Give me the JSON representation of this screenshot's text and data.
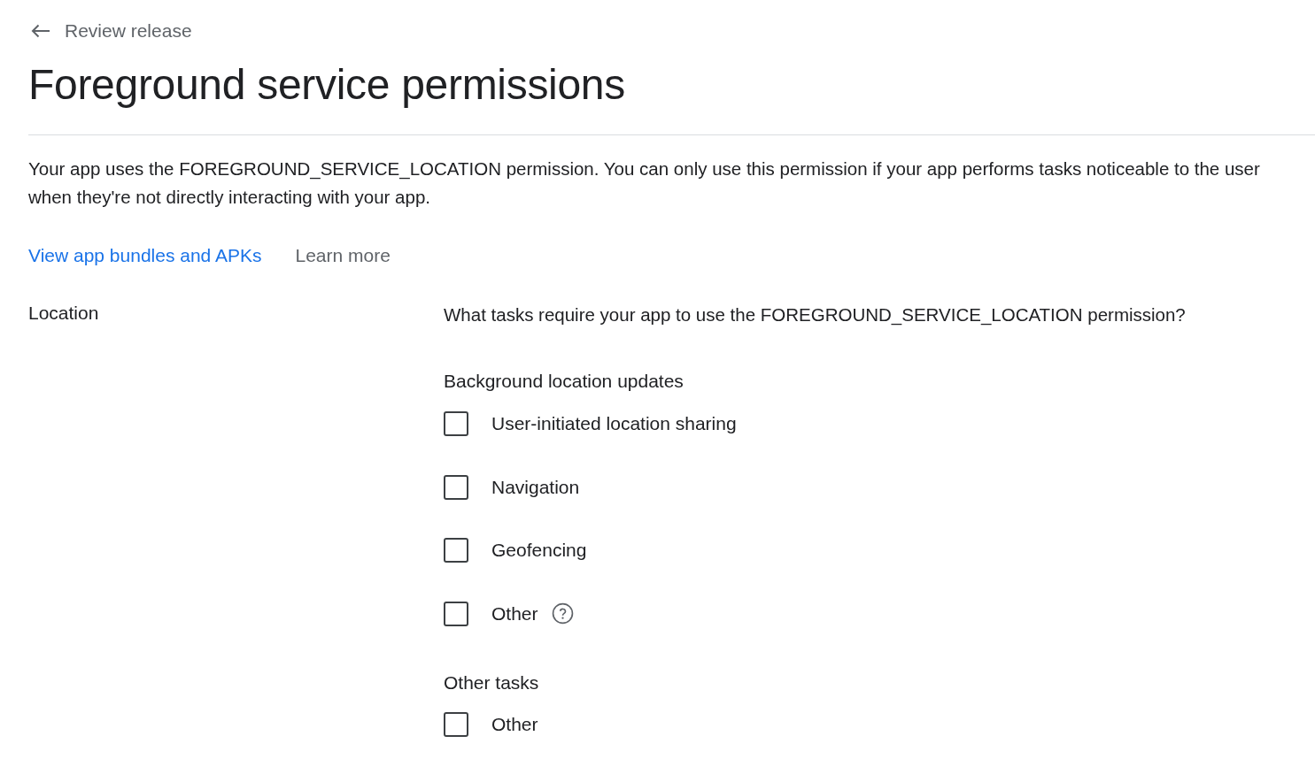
{
  "back_link": {
    "label": "Review release"
  },
  "title": "Foreground service permissions",
  "description": "Your app uses the FOREGROUND_SERVICE_LOCATION permission. You can only use this permission if your app performs tasks noticeable to the user when they're not directly interacting with your app.",
  "links": [
    {
      "label": "View app bundles and APKs",
      "kind": "primary"
    },
    {
      "label": "Learn more",
      "kind": "secondary"
    }
  ],
  "sections": [
    {
      "label": "Location",
      "question": "What tasks require your app to use the FOREGROUND_SERVICE_LOCATION permission?",
      "groups": [
        {
          "title": "Background location updates",
          "options": [
            {
              "label": "User-initiated location sharing",
              "checked": false,
              "help": false
            },
            {
              "label": "Navigation",
              "checked": false,
              "help": false
            },
            {
              "label": "Geofencing",
              "checked": false,
              "help": false
            },
            {
              "label": "Other",
              "checked": false,
              "help": true
            }
          ]
        },
        {
          "title": "Other tasks",
          "options": [
            {
              "label": "Other",
              "checked": false,
              "help": false
            }
          ]
        }
      ]
    }
  ]
}
